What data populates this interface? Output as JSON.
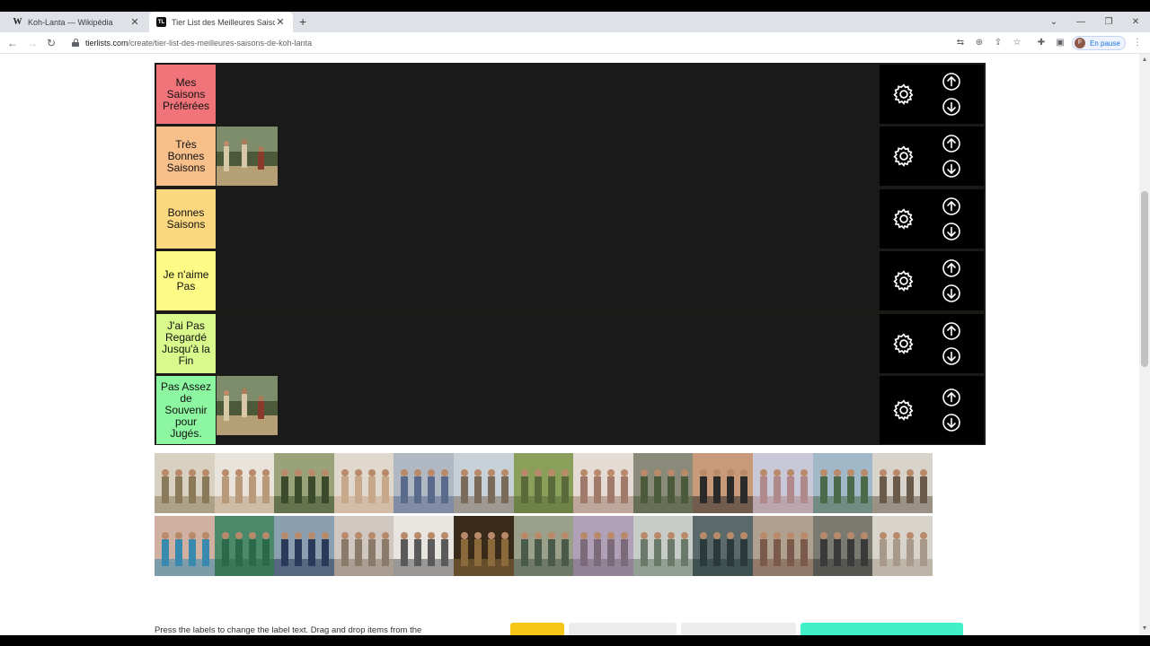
{
  "browser": {
    "tabs": [
      {
        "title": "Koh-Lanta — Wikipédia",
        "favicon": "W",
        "active": false
      },
      {
        "title": "Tier List des Meilleures Saisons d",
        "favicon": "TL",
        "active": true
      }
    ],
    "newtab_glyph": "+",
    "url_host": "tierlists.com",
    "url_path": "/create/tier-list-des-meilleures-saisons-de-koh-lanta",
    "profile": {
      "initial": "F",
      "label": "En pause"
    }
  },
  "tiers": [
    {
      "label": "Mes Saisons Préférées",
      "color": "#f0747a",
      "items": 0
    },
    {
      "label": "Très Bonnes Saisons",
      "color": "#f7c08a",
      "items": 1
    },
    {
      "label": "Bonnes Saisons",
      "color": "#fbd77f",
      "items": 0
    },
    {
      "label": "Je n'aime Pas",
      "color": "#fdfb86",
      "items": 0
    },
    {
      "label": "J'ai Pas Regardé Jusqu'à la Fin",
      "color": "#d9f98c",
      "items": 0
    },
    {
      "label": "Pas Assez de Souvenir pour Jugés.",
      "color": "#8cf7a0",
      "items": 1
    }
  ],
  "icons": {
    "settings": "gear-icon",
    "move_up": "arrow-up-circle-icon",
    "move_down": "arrow-down-circle-icon"
  },
  "pool_count": 26,
  "instructions": "Press the labels to change the label text. Drag and drop items from the"
}
